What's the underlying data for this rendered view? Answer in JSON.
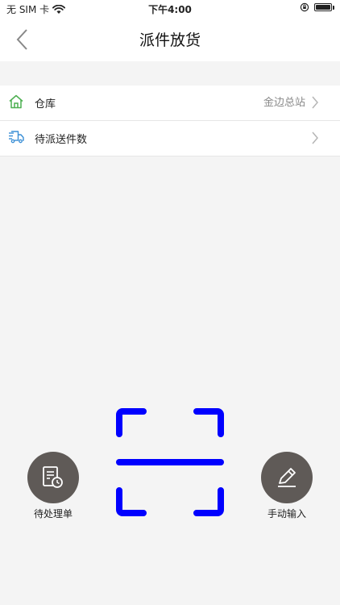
{
  "status_bar": {
    "carrier": "无 SIM 卡",
    "time": "下午4:00",
    "battery_level": 1.0
  },
  "nav": {
    "title": "派件放货"
  },
  "list": {
    "rows": [
      {
        "label": "仓库",
        "value": "金边总站",
        "icon": "home-icon"
      },
      {
        "label": "待派送件数",
        "value": "",
        "icon": "delivery-truck-icon"
      }
    ]
  },
  "actions": {
    "pending": {
      "label": "待处理单",
      "icon": "pending-document-icon"
    },
    "scan": {
      "icon": "scan-frame-icon",
      "color": "#0000ff"
    },
    "manual": {
      "label": "手动输入",
      "icon": "pencil-icon"
    }
  },
  "colors": {
    "home_icon": "#4caf50",
    "truck_icon": "#3a8fd6",
    "fab_background": "#5f5a57",
    "scan_frame": "#0000ff"
  }
}
